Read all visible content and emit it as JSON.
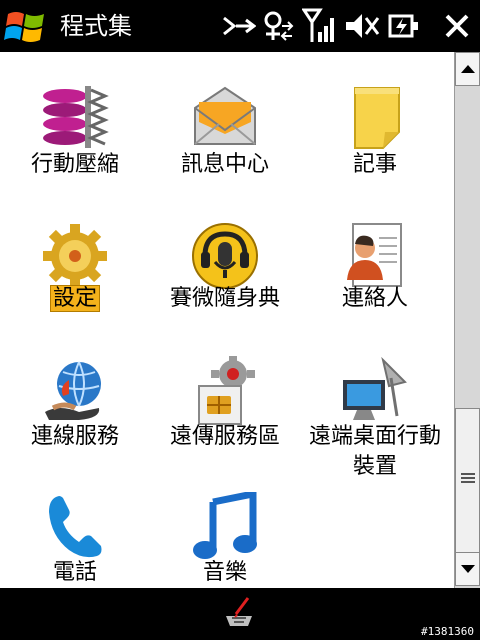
{
  "title_bar": {
    "title": "程式集",
    "tray_icons": [
      "connectivity-icon",
      "sync-icon",
      "signal-icon",
      "volume-muted-icon",
      "battery-charging-icon",
      "close-icon"
    ]
  },
  "apps": [
    {
      "label": "行動壓縮",
      "icon": "compression-icon"
    },
    {
      "label": "訊息中心",
      "icon": "envelope-icon"
    },
    {
      "label": "記事",
      "icon": "note-icon"
    },
    {
      "label": "設定",
      "icon": "gear-icon",
      "selected": true
    },
    {
      "label": "賽微隨身典",
      "icon": "microphone-icon"
    },
    {
      "label": "連絡人",
      "icon": "contact-card-icon"
    },
    {
      "label": "連線服務",
      "icon": "globe-icon"
    },
    {
      "label": "遠傳服務區",
      "icon": "sim-card-icon"
    },
    {
      "label": "遠端桌面行動",
      "label2": "裝置",
      "icon": "remote-desktop-icon"
    },
    {
      "label": "電話",
      "icon": "phone-icon"
    },
    {
      "label": "音樂",
      "icon": "music-note-icon"
    }
  ],
  "colors": {
    "selected_highlight": "#f4b21b",
    "bar_background": "#000000"
  },
  "watermark": "#1381360"
}
